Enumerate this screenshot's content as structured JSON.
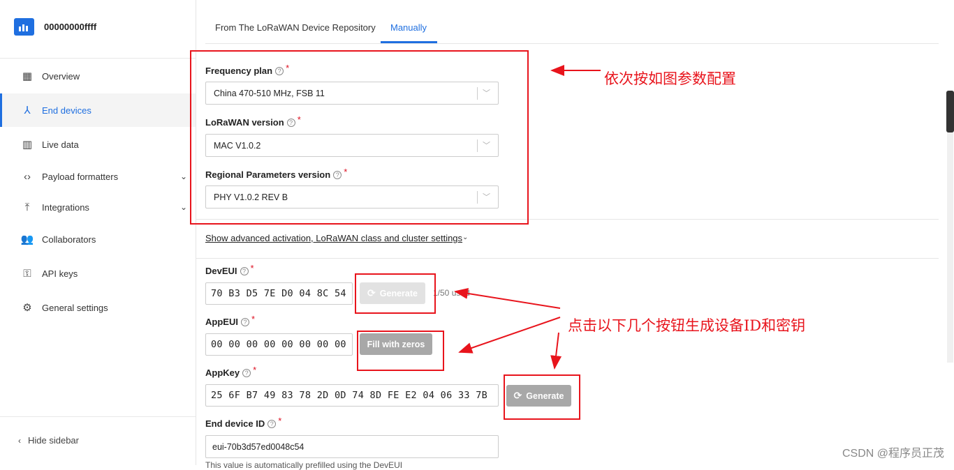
{
  "app": {
    "name": "00000000ffff"
  },
  "sidebar": {
    "items": [
      {
        "label": "Overview",
        "icon": "overview-icon",
        "active": false
      },
      {
        "label": "End devices",
        "icon": "end-devices-icon",
        "active": true
      },
      {
        "label": "Live data",
        "icon": "live-data-icon",
        "active": false
      },
      {
        "label": "Payload formatters",
        "icon": "code-icon",
        "active": false,
        "expandable": true
      },
      {
        "label": "Integrations",
        "icon": "integrations-icon",
        "active": false,
        "expandable": true
      },
      {
        "label": "Collaborators",
        "icon": "collaborators-icon",
        "active": false
      },
      {
        "label": "API keys",
        "icon": "key-icon",
        "active": false
      },
      {
        "label": "General settings",
        "icon": "gear-icon",
        "active": false
      }
    ],
    "hide_label": "Hide sidebar"
  },
  "tabs": [
    {
      "label": "From The LoRaWAN Device Repository",
      "active": false
    },
    {
      "label": "Manually",
      "active": true
    }
  ],
  "form": {
    "frequency_plan": {
      "label": "Frequency plan",
      "value": "China 470-510 MHz, FSB 11"
    },
    "lorawan_version": {
      "label": "LoRaWAN version",
      "value": "MAC V1.0.2"
    },
    "regional_version": {
      "label": "Regional Parameters version",
      "value": "PHY V1.0.2 REV B"
    },
    "advanced_link": "Show advanced activation, LoRaWAN class and cluster settings",
    "dev_eui": {
      "label": "DevEUI",
      "value": "70 B3 D5 7E D0 04 8C 54",
      "button": "Generate",
      "used": "1/50 used"
    },
    "app_eui": {
      "label": "AppEUI",
      "value": "00 00 00 00 00 00 00 00",
      "button": "Fill with zeros"
    },
    "app_key": {
      "label": "AppKey",
      "value": "25 6F B7 49 83 78 2D 0D 74 8D FE E2 04 06 33 7B",
      "button": "Generate"
    },
    "end_device_id": {
      "label": "End device ID",
      "value": "eui-70b3d57ed0048c54",
      "helper": "This value is automatically prefilled using the DevEUI"
    }
  },
  "annotations": {
    "config_note": "依次按如图参数配置",
    "generate_note": "点击以下几个按钮生成设备ID和密钥"
  },
  "watermark": "CSDN @程序员正茂",
  "colors": {
    "accent": "#1f6fe0",
    "annotation": "#e8141c",
    "required": "#dd1122"
  }
}
